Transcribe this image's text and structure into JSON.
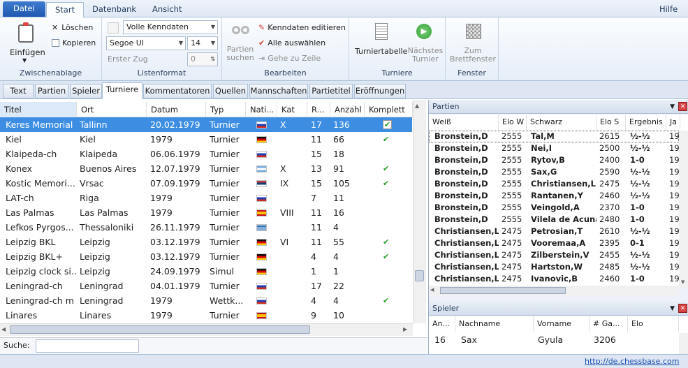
{
  "menu": {
    "file": "Datei",
    "tabs": [
      "Start",
      "Datenbank",
      "Ansicht"
    ],
    "help": "Hilfe"
  },
  "ribbon": {
    "clipboard": {
      "paste": "Einfügen",
      "delete": "Löschen",
      "copy": "Kopieren",
      "label": "Zwischenablage"
    },
    "listformat": {
      "format": "Volle Kenndaten",
      "font": "Segoe UI",
      "size": "14",
      "first_move_label": "Erster Zug",
      "first_move": "0",
      "label": "Listenformat"
    },
    "edit": {
      "search": "Partien suchen",
      "edit_header": "Kenndaten editieren",
      "select_all": "Alle auswählen",
      "goto_line": "Gehe zu Zeile",
      "label": "Bearbeiten"
    },
    "tournaments": {
      "table": "Turniertabelle",
      "next": "Nächstes Turnier",
      "label": "Turniere"
    },
    "window": {
      "board": "Zum Brettfenster",
      "label": "Fenster"
    }
  },
  "doc_tabs": [
    "Text",
    "Partien",
    "Spieler",
    "Turniere",
    "Kommentatoren",
    "Quellen",
    "Mannschaften",
    "Partietitel",
    "Eröffnungen"
  ],
  "tournaments": {
    "columns": [
      "Titel",
      "Ort",
      "Datum",
      "Typ",
      "Nati...",
      "Kat",
      "R...",
      "Anzahl",
      "Komplett"
    ],
    "rows": [
      {
        "title": "Keres Memorial",
        "place": "Tallinn",
        "date": "20.02.1979",
        "type": "Turnier",
        "flag": "ru",
        "cat": "X",
        "rounds": "17",
        "count": "136",
        "complete": true,
        "selected": true
      },
      {
        "title": "Kiel",
        "place": "Kiel",
        "date": "1979",
        "type": "Turnier",
        "flag": "de",
        "cat": "",
        "rounds": "11",
        "count": "66",
        "complete": true
      },
      {
        "title": "Klaipeda-ch",
        "place": "Klaipeda",
        "date": "06.06.1979",
        "type": "Turnier",
        "flag": "ru",
        "cat": "",
        "rounds": "15",
        "count": "18",
        "complete": false
      },
      {
        "title": "Konex",
        "place": "Buenos Aires",
        "date": "12.07.1979",
        "type": "Turnier",
        "flag": "ar",
        "cat": "X",
        "rounds": "13",
        "count": "91",
        "complete": true
      },
      {
        "title": "Kostic Memori...",
        "place": "Vrsac",
        "date": "07.09.1979",
        "type": "Turnier",
        "flag": "rs",
        "cat": "IX",
        "rounds": "15",
        "count": "105",
        "complete": true
      },
      {
        "title": "LAT-ch",
        "place": "Riga",
        "date": "1979",
        "type": "Turnier",
        "flag": "ru",
        "cat": "",
        "rounds": "7",
        "count": "11",
        "complete": false
      },
      {
        "title": "Las Palmas",
        "place": "Las Palmas",
        "date": "1979",
        "type": "Turnier",
        "flag": "es",
        "cat": "VIII",
        "rounds": "11",
        "count": "16",
        "complete": false
      },
      {
        "title": "Lefkos Pyrgos...",
        "place": "Thessaloniki",
        "date": "26.11.1979",
        "type": "Turnier",
        "flag": "gr",
        "cat": "",
        "rounds": "11",
        "count": "4",
        "complete": false
      },
      {
        "title": "Leipzig BKL",
        "place": "Leipzig",
        "date": "03.12.1979",
        "type": "Turnier",
        "flag": "de",
        "cat": "VI",
        "rounds": "11",
        "count": "55",
        "complete": true
      },
      {
        "title": "Leipzig BKL+",
        "place": "Leipzig",
        "date": "03.12.1979",
        "type": "Turnier",
        "flag": "de",
        "cat": "",
        "rounds": "4",
        "count": "4",
        "complete": true
      },
      {
        "title": "Leipzig clock si...",
        "place": "Leipzig",
        "date": "24.09.1979",
        "type": "Simul",
        "flag": "de",
        "cat": "",
        "rounds": "1",
        "count": "1",
        "complete": false
      },
      {
        "title": "Leningrad-ch",
        "place": "Leningrad",
        "date": "04.01.1979",
        "type": "Turnier",
        "flag": "ru",
        "cat": "",
        "rounds": "17",
        "count": "22",
        "complete": false
      },
      {
        "title": "Leningrad-ch m",
        "place": "Leningrad",
        "date": "1979",
        "type": "Wettk...",
        "flag": "ru",
        "cat": "",
        "rounds": "4",
        "count": "4",
        "complete": true
      },
      {
        "title": "Linares",
        "place": "Linares",
        "date": "1979",
        "type": "Turnier",
        "flag": "es",
        "cat": "",
        "rounds": "9",
        "count": "10",
        "complete": false
      }
    ]
  },
  "search": {
    "label": "Suche:",
    "value": ""
  },
  "games_panel": {
    "title": "Partien",
    "columns": [
      "Weiß",
      "Elo W",
      "Schwarz",
      "Elo S",
      "Ergebnis",
      "Ja"
    ],
    "rows": [
      [
        "Bronstein,D",
        "2555",
        "Tal,M",
        "2615",
        "½-½",
        "19"
      ],
      [
        "Bronstein,D",
        "2555",
        "Nei,I",
        "2500",
        "½-½",
        "19"
      ],
      [
        "Bronstein,D",
        "2555",
        "Rytov,B",
        "2400",
        "1-0",
        "19"
      ],
      [
        "Bronstein,D",
        "2555",
        "Sax,G",
        "2590",
        "½-½",
        "19"
      ],
      [
        "Bronstein,D",
        "2555",
        "Christiansen,L",
        "2475",
        "½-½",
        "19"
      ],
      [
        "Bronstein,D",
        "2555",
        "Rantanen,Y",
        "2460",
        "½-½",
        "19"
      ],
      [
        "Bronstein,D",
        "2555",
        "Veingold,A",
        "2370",
        "1-0",
        "19"
      ],
      [
        "Bronstein,D",
        "2555",
        "Vilela de Acuna...",
        "2480",
        "1-0",
        "19"
      ],
      [
        "Christiansen,L",
        "2475",
        "Petrosian,T",
        "2610",
        "½-½",
        "19"
      ],
      [
        "Christiansen,L",
        "2475",
        "Vooremaa,A",
        "2395",
        "0-1",
        "19"
      ],
      [
        "Christiansen,L",
        "2475",
        "Zilberstein,V",
        "2455",
        "½-½",
        "19"
      ],
      [
        "Christiansen,L",
        "2475",
        "Hartston,W",
        "2485",
        "½-½",
        "19"
      ],
      [
        "Christiansen,L",
        "2475",
        "Ivanovic,B",
        "2460",
        "1-0",
        "19"
      ]
    ]
  },
  "players_panel": {
    "title": "Spieler",
    "columns": [
      "An...",
      "Nachname",
      "Vorname",
      "# Ga...",
      "Elo"
    ],
    "rows": [
      [
        "16",
        "Sax",
        "Gyula",
        "3206",
        ""
      ]
    ]
  },
  "status": {
    "link": "http://de.chessbase.com"
  },
  "colors": {
    "accent": "#3d8ee3",
    "check": "#2aa02a"
  }
}
